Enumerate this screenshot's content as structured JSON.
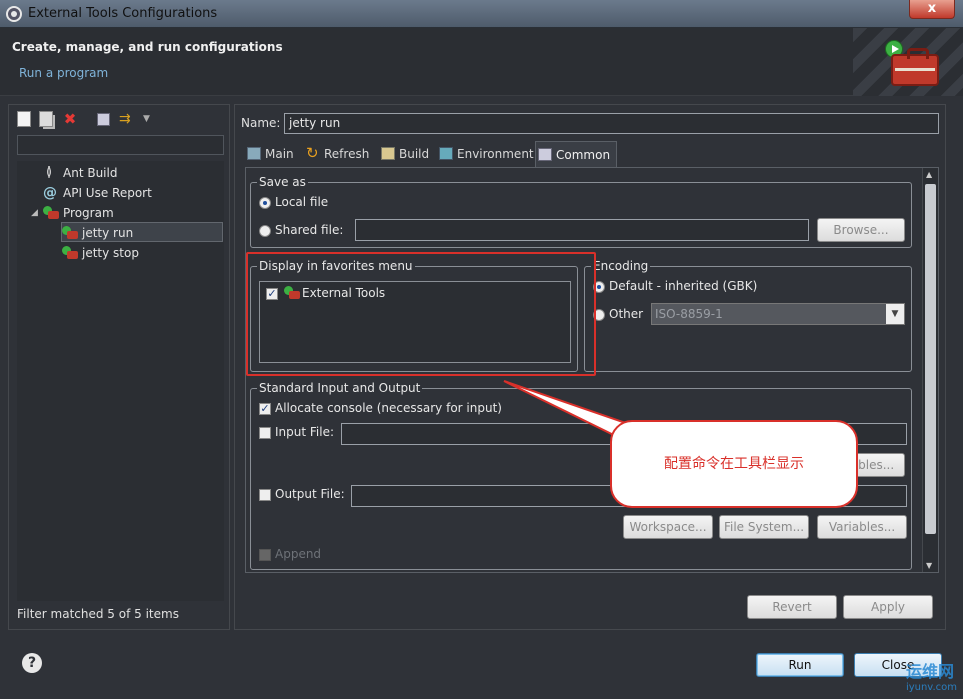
{
  "window": {
    "title": "External Tools Configurations",
    "close_label": "x"
  },
  "header": {
    "title": "Create, manage, and run configurations",
    "subtitle": "Run a program"
  },
  "left": {
    "filter_value": "",
    "tree": [
      {
        "label": "Ant Build",
        "icon": "ant-build-icon"
      },
      {
        "label": "API Use Report",
        "icon": "api-report-icon"
      },
      {
        "label": "Program",
        "icon": "program-icon",
        "expanded": true
      },
      {
        "label": "jetty run",
        "icon": "external-tool-icon",
        "selected": true
      },
      {
        "label": "jetty stop",
        "icon": "external-tool-icon"
      }
    ],
    "status": "Filter matched 5 of 5 items"
  },
  "right": {
    "name_label": "Name:",
    "name_value": "jetty run",
    "tabs": [
      {
        "label": "Main",
        "icon": "main-tab-icon"
      },
      {
        "label": "Refresh",
        "icon": "refresh-icon"
      },
      {
        "label": "Build",
        "icon": "build-icon"
      },
      {
        "label": "Environment",
        "icon": "environment-icon"
      },
      {
        "label": "Common",
        "icon": "common-icon",
        "active": true
      }
    ],
    "save_as": {
      "title": "Save as",
      "local_file": "Local file",
      "shared_file": "Shared file:",
      "browse": "Browse..."
    },
    "favorites": {
      "title": "Display in favorites menu",
      "items": [
        {
          "label": "External Tools",
          "checked": true
        }
      ]
    },
    "encoding": {
      "title": "Encoding",
      "default_label": "Default - inherited (GBK)",
      "other_label": "Other",
      "other_value": "ISO-8859-1"
    },
    "stdio": {
      "title": "Standard Input and Output",
      "allocate_console": "Allocate console (necessary for input)",
      "input_file": "Input File:",
      "input_variables": "Variables...",
      "output_file": "Output File:",
      "workspace": "Workspace...",
      "file_system": "File System...",
      "variables": "Variables...",
      "append": "Append"
    },
    "revert": "Revert",
    "apply": "Apply"
  },
  "callout": {
    "text": "配置命令在工具栏显示"
  },
  "bottom": {
    "help": "?",
    "run": "Run",
    "close": "Close"
  },
  "watermark": {
    "text": "运维网",
    "sub": "iyunv.com"
  },
  "colors": {
    "annotation_red": "#d9302a",
    "link_blue": "#7fb3d9",
    "background": "#2f3238"
  }
}
